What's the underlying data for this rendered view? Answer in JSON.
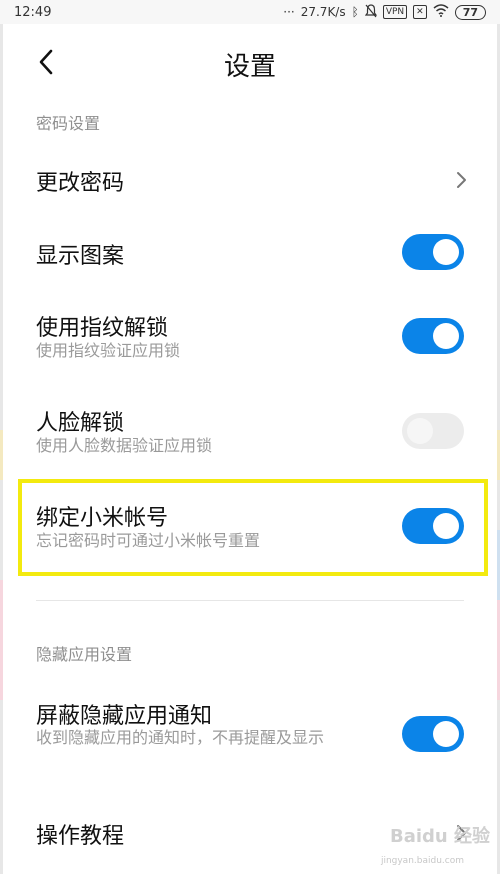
{
  "status_bar": {
    "time": "12:49",
    "speed": "27.7K/s",
    "vpn_label": "VPN",
    "battery": "77"
  },
  "header": {
    "title": "设置"
  },
  "sections": {
    "password": {
      "header": "密码设置"
    },
    "hidden_apps": {
      "header": "隐藏应用设置"
    }
  },
  "rows": {
    "change_password": {
      "title": "更改密码"
    },
    "show_pattern": {
      "title": "显示图案",
      "enabled": true
    },
    "fingerprint": {
      "title": "使用指纹解锁",
      "subtitle": "使用指纹验证应用锁",
      "enabled": true
    },
    "face": {
      "title": "人脸解锁",
      "subtitle": "使用人脸数据验证应用锁",
      "enabled": false
    },
    "mi_account": {
      "title": "绑定小米帐号",
      "subtitle": "忘记密码时可通过小米帐号重置",
      "enabled": true
    },
    "hide_notifications": {
      "title": "屏蔽隐藏应用通知",
      "subtitle": "收到隐藏应用的通知时，不再提醒及显示",
      "enabled": true
    },
    "tutorial": {
      "title": "操作教程"
    }
  },
  "watermark": {
    "logo_text": "Baidu 经验",
    "url": "jingyan.baidu.com"
  },
  "colors": {
    "accent": "#0b84e8",
    "highlight": "#f3ea0f"
  }
}
